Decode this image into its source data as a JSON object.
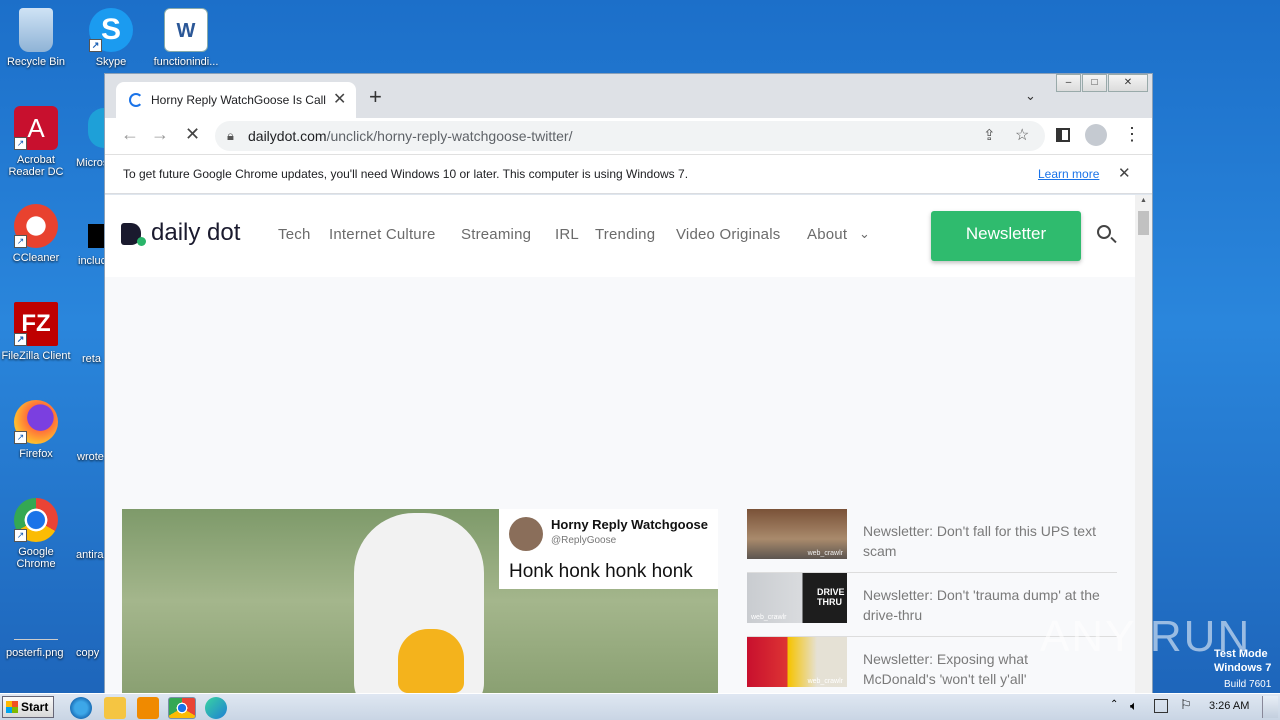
{
  "desktop": {
    "icons": [
      {
        "label": "Recycle Bin"
      },
      {
        "label": "Skype"
      },
      {
        "label": "functionindi..."
      },
      {
        "label": "Acrobat Reader DC"
      },
      {
        "label": "Micros"
      },
      {
        "label": "CCleaner"
      },
      {
        "label": "incluc"
      },
      {
        "label": "FileZilla Client"
      },
      {
        "label": "reta"
      },
      {
        "label": "Firefox"
      },
      {
        "label": "wrote"
      },
      {
        "label": "Google Chrome"
      },
      {
        "label": "antira"
      },
      {
        "label": "posterfi.png"
      },
      {
        "label": "copy"
      }
    ]
  },
  "browser": {
    "tab_title": "Horny Reply WatchGoose Is Calling",
    "url_host": "dailydot.com",
    "url_path": "/unclick/horny-reply-watchgoose-twitter/",
    "infobar_text": "To get future Google Chrome updates, you'll need Windows 10 or later. This computer is using Windows 7.",
    "infobar_link": "Learn more"
  },
  "site": {
    "logo": "daily dot",
    "nav": [
      "Tech",
      "Internet Culture",
      "Streaming",
      "IRL",
      "Trending",
      "Video Originals",
      "About"
    ],
    "newsletter_button": "Newsletter",
    "tweet": {
      "name": "Horny Reply Watchgoose",
      "handle": "@ReplyGoose",
      "text": "Honk honk honk honk"
    },
    "cards": [
      {
        "title": "Newsletter: Don't fall for this UPS text scam",
        "thumb_caption": "web_crawlr"
      },
      {
        "title": "Newsletter: Don't 'trauma dump' at the drive-thru",
        "thumb_caption": "web_crawlr",
        "thumb_sign": "DRIVE THRU"
      },
      {
        "title": "Newsletter: Exposing what McDonald's 'won't tell y'all'",
        "thumb_caption": "web_crawlr"
      }
    ]
  },
  "watermark": {
    "brand": "ANY RUN",
    "test_mode": "Test Mode",
    "os": "Windows 7",
    "build": "Build 7601"
  },
  "taskbar": {
    "start": "Start",
    "clock": "3:26 AM"
  }
}
